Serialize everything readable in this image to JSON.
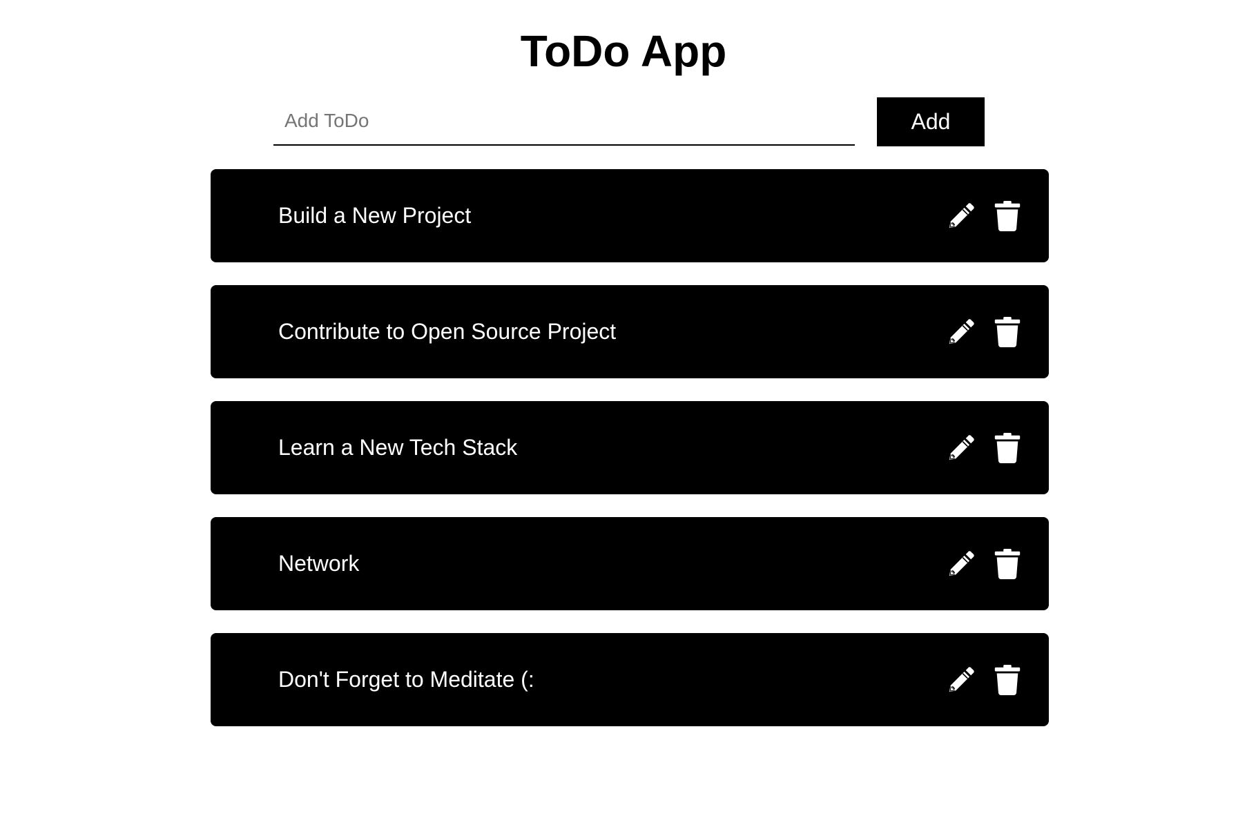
{
  "header": {
    "title": "ToDo App"
  },
  "add_form": {
    "input_value": "",
    "input_placeholder": "Add ToDo",
    "add_button_label": "Add"
  },
  "todos": [
    {
      "text": "Build a New Project"
    },
    {
      "text": "Contribute to Open Source Project"
    },
    {
      "text": "Learn a New Tech Stack"
    },
    {
      "text": "Network"
    },
    {
      "text": "Don't Forget to Meditate (:"
    }
  ],
  "icons": {
    "edit": "pencil-icon",
    "delete": "trash-icon"
  },
  "colors": {
    "background": "#ffffff",
    "item_background": "#000000",
    "item_text": "#ffffff",
    "button_background": "#000000",
    "placeholder": "#757575"
  }
}
